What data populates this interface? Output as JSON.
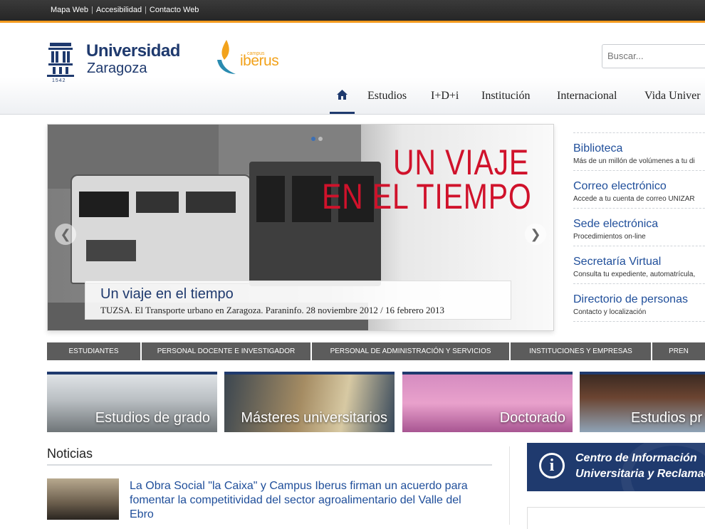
{
  "topbar": {
    "links": [
      "Mapa Web",
      "Accesibilidad",
      "Contacto Web"
    ],
    "accent_color": "#f39a1e"
  },
  "header": {
    "logo": {
      "line1": "Universidad",
      "line2": "Zaragoza",
      "year": "1542"
    },
    "partner": {
      "small": "campus",
      "name": "iberus"
    },
    "search": {
      "placeholder": "Buscar..."
    }
  },
  "nav": {
    "home_icon": "home-icon",
    "items": [
      "Estudios",
      "I+D+i",
      "Institución",
      "Internacional",
      "Vida Univer"
    ]
  },
  "slider": {
    "headline_line1": "UN VIAJE",
    "headline_line2": "EN EL TIEMPO",
    "caption_title": "Un viaje en el tiempo",
    "caption_sub": "TUZSA. El Transporte urbano en Zaragoza. Paraninfo. 28 noviembre 2012 / 16 febrero 2013",
    "prev_icon": "arrow-left-icon",
    "next_icon": "arrow-right-icon"
  },
  "quick_links": [
    {
      "title": "Biblioteca",
      "sub": "Más de un millón de volúmenes a tu di"
    },
    {
      "title": "Correo electrónico",
      "sub": "Accede a tu cuenta de correo UNIZAR"
    },
    {
      "title": "Sede electrónica",
      "sub": "Procedimientos on-line"
    },
    {
      "title": "Secretaría Virtual",
      "sub": "Consulta tu expediente, automatrícula,"
    },
    {
      "title": "Directorio de personas",
      "sub": "Contacto y localización"
    }
  ],
  "audience": [
    "ESTUDIANTES",
    "PERSONAL DOCENTE E INVESTIGADOR",
    "PERSONAL DE ADMINISTRACIÓN Y SERVICIOS",
    "INSTITUCIONES Y EMPRESAS",
    "PREN"
  ],
  "tiles": [
    "Estudios de grado",
    "Másteres universitarios",
    "Doctorado",
    "Estudios pr"
  ],
  "news": {
    "heading": "Noticias",
    "item_text": "La Obra Social \"la Caixa\" y Campus Iberus firman un acuerdo para fomentar la competitividad del sector agroalimentario del Valle del Ebro"
  },
  "infobox": {
    "line1": "Centro de Información",
    "line2": "Universitaria y Reclamac",
    "icon": "info-icon",
    "color": "#1f3a6e"
  }
}
